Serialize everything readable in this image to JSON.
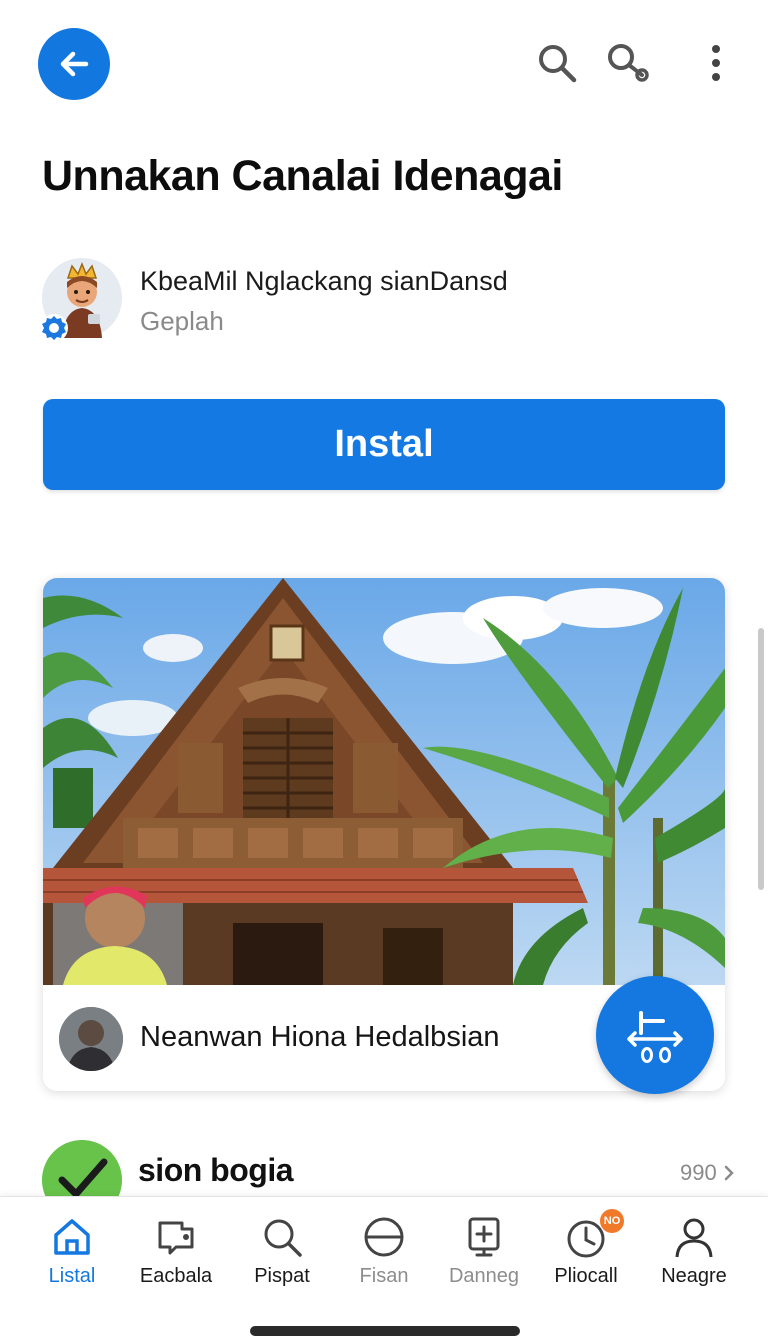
{
  "header": {
    "title": "Unnakan Canalai Idenagai"
  },
  "developer": {
    "name": "KbeaMil Nglackang sianDansd",
    "subtitle": "Geplah"
  },
  "install": {
    "label": "Instal",
    "color": "#1479e2"
  },
  "feature_card": {
    "creator_name": "Neanwan Hiona Hedalbsian"
  },
  "next_item": {
    "title": "sion bogia",
    "count": "990"
  },
  "bottom_nav": {
    "items": [
      {
        "label": "Listal",
        "icon": "home-icon",
        "active": true
      },
      {
        "label": "Eacbala",
        "icon": "tag-icon"
      },
      {
        "label": "Pispat",
        "icon": "search-icon"
      },
      {
        "label": "Fisan",
        "icon": "circle-icon"
      },
      {
        "label": "Danneg",
        "icon": "add-device-icon"
      },
      {
        "label": "Pliocall",
        "icon": "clock-icon",
        "badge": "NO"
      },
      {
        "label": "Neagre",
        "icon": "profile-icon"
      }
    ]
  },
  "colors": {
    "accent": "#1478e0",
    "muted_text": "#8a8a8a",
    "badge": "#f07a2a"
  }
}
